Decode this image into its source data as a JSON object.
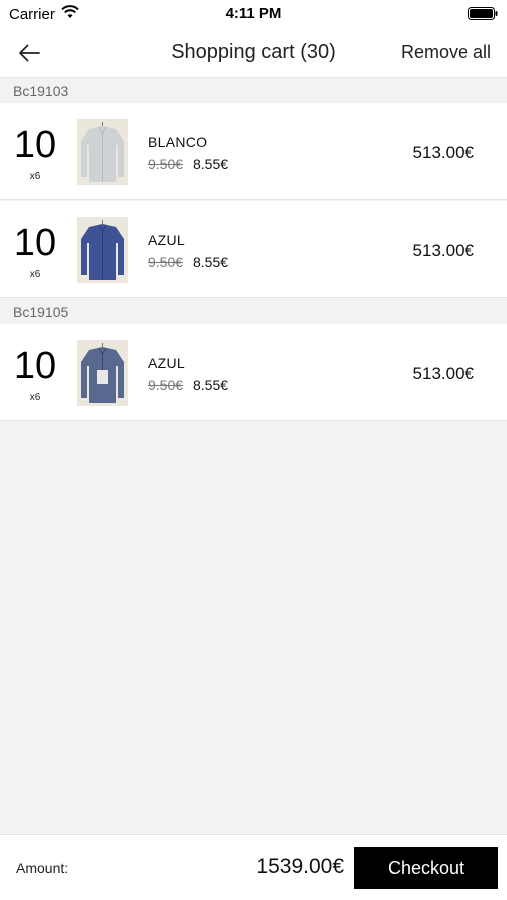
{
  "status": {
    "carrier": "Carrier",
    "time": "4:11 PM"
  },
  "nav": {
    "title": "Shopping cart (30)",
    "remove_all": "Remove all"
  },
  "groups": [
    {
      "code": "Bc19103",
      "items": [
        {
          "qty": "10",
          "mult": "x6",
          "name": "BLANCO",
          "price_old": "9.50€",
          "price_new": "8.55€",
          "total": "513.00€",
          "shirt_color": "#cfd2d4"
        },
        {
          "qty": "10",
          "mult": "x6",
          "name": "AZUL",
          "price_old": "9.50€",
          "price_new": "8.55€",
          "total": "513.00€",
          "shirt_color": "#3e5295"
        }
      ]
    },
    {
      "code": "Bc19105",
      "items": [
        {
          "qty": "10",
          "mult": "x6",
          "name": "AZUL",
          "price_old": "9.50€",
          "price_new": "8.55€",
          "total": "513.00€",
          "shirt_color": "#59688f"
        }
      ]
    }
  ],
  "footer": {
    "amount_label": "Amount:",
    "amount_value": "1539.00€",
    "checkout_label": "Checkout"
  },
  "icons": {
    "back": "arrow-left-icon",
    "wifi": "wifi-icon",
    "battery": "battery-icon"
  }
}
